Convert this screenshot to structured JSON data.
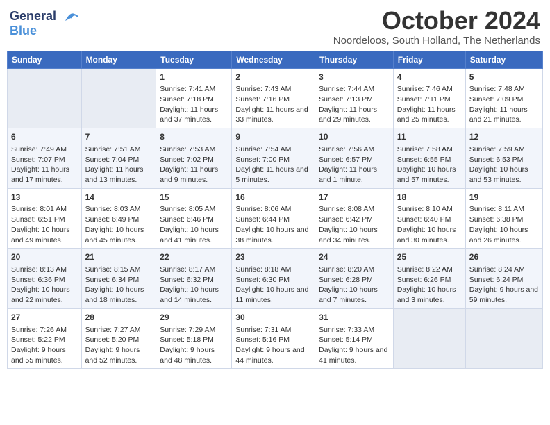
{
  "logo": {
    "line1": "General",
    "line2": "Blue"
  },
  "title": "October 2024",
  "subtitle": "Noordeloos, South Holland, The Netherlands",
  "days_header": [
    "Sunday",
    "Monday",
    "Tuesday",
    "Wednesday",
    "Thursday",
    "Friday",
    "Saturday"
  ],
  "weeks": [
    [
      {
        "day": "",
        "sunrise": "",
        "sunset": "",
        "daylight": ""
      },
      {
        "day": "",
        "sunrise": "",
        "sunset": "",
        "daylight": ""
      },
      {
        "day": "1",
        "sunrise": "Sunrise: 7:41 AM",
        "sunset": "Sunset: 7:18 PM",
        "daylight": "Daylight: 11 hours and 37 minutes."
      },
      {
        "day": "2",
        "sunrise": "Sunrise: 7:43 AM",
        "sunset": "Sunset: 7:16 PM",
        "daylight": "Daylight: 11 hours and 33 minutes."
      },
      {
        "day": "3",
        "sunrise": "Sunrise: 7:44 AM",
        "sunset": "Sunset: 7:13 PM",
        "daylight": "Daylight: 11 hours and 29 minutes."
      },
      {
        "day": "4",
        "sunrise": "Sunrise: 7:46 AM",
        "sunset": "Sunset: 7:11 PM",
        "daylight": "Daylight: 11 hours and 25 minutes."
      },
      {
        "day": "5",
        "sunrise": "Sunrise: 7:48 AM",
        "sunset": "Sunset: 7:09 PM",
        "daylight": "Daylight: 11 hours and 21 minutes."
      }
    ],
    [
      {
        "day": "6",
        "sunrise": "Sunrise: 7:49 AM",
        "sunset": "Sunset: 7:07 PM",
        "daylight": "Daylight: 11 hours and 17 minutes."
      },
      {
        "day": "7",
        "sunrise": "Sunrise: 7:51 AM",
        "sunset": "Sunset: 7:04 PM",
        "daylight": "Daylight: 11 hours and 13 minutes."
      },
      {
        "day": "8",
        "sunrise": "Sunrise: 7:53 AM",
        "sunset": "Sunset: 7:02 PM",
        "daylight": "Daylight: 11 hours and 9 minutes."
      },
      {
        "day": "9",
        "sunrise": "Sunrise: 7:54 AM",
        "sunset": "Sunset: 7:00 PM",
        "daylight": "Daylight: 11 hours and 5 minutes."
      },
      {
        "day": "10",
        "sunrise": "Sunrise: 7:56 AM",
        "sunset": "Sunset: 6:57 PM",
        "daylight": "Daylight: 11 hours and 1 minute."
      },
      {
        "day": "11",
        "sunrise": "Sunrise: 7:58 AM",
        "sunset": "Sunset: 6:55 PM",
        "daylight": "Daylight: 10 hours and 57 minutes."
      },
      {
        "day": "12",
        "sunrise": "Sunrise: 7:59 AM",
        "sunset": "Sunset: 6:53 PM",
        "daylight": "Daylight: 10 hours and 53 minutes."
      }
    ],
    [
      {
        "day": "13",
        "sunrise": "Sunrise: 8:01 AM",
        "sunset": "Sunset: 6:51 PM",
        "daylight": "Daylight: 10 hours and 49 minutes."
      },
      {
        "day": "14",
        "sunrise": "Sunrise: 8:03 AM",
        "sunset": "Sunset: 6:49 PM",
        "daylight": "Daylight: 10 hours and 45 minutes."
      },
      {
        "day": "15",
        "sunrise": "Sunrise: 8:05 AM",
        "sunset": "Sunset: 6:46 PM",
        "daylight": "Daylight: 10 hours and 41 minutes."
      },
      {
        "day": "16",
        "sunrise": "Sunrise: 8:06 AM",
        "sunset": "Sunset: 6:44 PM",
        "daylight": "Daylight: 10 hours and 38 minutes."
      },
      {
        "day": "17",
        "sunrise": "Sunrise: 8:08 AM",
        "sunset": "Sunset: 6:42 PM",
        "daylight": "Daylight: 10 hours and 34 minutes."
      },
      {
        "day": "18",
        "sunrise": "Sunrise: 8:10 AM",
        "sunset": "Sunset: 6:40 PM",
        "daylight": "Daylight: 10 hours and 30 minutes."
      },
      {
        "day": "19",
        "sunrise": "Sunrise: 8:11 AM",
        "sunset": "Sunset: 6:38 PM",
        "daylight": "Daylight: 10 hours and 26 minutes."
      }
    ],
    [
      {
        "day": "20",
        "sunrise": "Sunrise: 8:13 AM",
        "sunset": "Sunset: 6:36 PM",
        "daylight": "Daylight: 10 hours and 22 minutes."
      },
      {
        "day": "21",
        "sunrise": "Sunrise: 8:15 AM",
        "sunset": "Sunset: 6:34 PM",
        "daylight": "Daylight: 10 hours and 18 minutes."
      },
      {
        "day": "22",
        "sunrise": "Sunrise: 8:17 AM",
        "sunset": "Sunset: 6:32 PM",
        "daylight": "Daylight: 10 hours and 14 minutes."
      },
      {
        "day": "23",
        "sunrise": "Sunrise: 8:18 AM",
        "sunset": "Sunset: 6:30 PM",
        "daylight": "Daylight: 10 hours and 11 minutes."
      },
      {
        "day": "24",
        "sunrise": "Sunrise: 8:20 AM",
        "sunset": "Sunset: 6:28 PM",
        "daylight": "Daylight: 10 hours and 7 minutes."
      },
      {
        "day": "25",
        "sunrise": "Sunrise: 8:22 AM",
        "sunset": "Sunset: 6:26 PM",
        "daylight": "Daylight: 10 hours and 3 minutes."
      },
      {
        "day": "26",
        "sunrise": "Sunrise: 8:24 AM",
        "sunset": "Sunset: 6:24 PM",
        "daylight": "Daylight: 9 hours and 59 minutes."
      }
    ],
    [
      {
        "day": "27",
        "sunrise": "Sunrise: 7:26 AM",
        "sunset": "Sunset: 5:22 PM",
        "daylight": "Daylight: 9 hours and 55 minutes."
      },
      {
        "day": "28",
        "sunrise": "Sunrise: 7:27 AM",
        "sunset": "Sunset: 5:20 PM",
        "daylight": "Daylight: 9 hours and 52 minutes."
      },
      {
        "day": "29",
        "sunrise": "Sunrise: 7:29 AM",
        "sunset": "Sunset: 5:18 PM",
        "daylight": "Daylight: 9 hours and 48 minutes."
      },
      {
        "day": "30",
        "sunrise": "Sunrise: 7:31 AM",
        "sunset": "Sunset: 5:16 PM",
        "daylight": "Daylight: 9 hours and 44 minutes."
      },
      {
        "day": "31",
        "sunrise": "Sunrise: 7:33 AM",
        "sunset": "Sunset: 5:14 PM",
        "daylight": "Daylight: 9 hours and 41 minutes."
      },
      {
        "day": "",
        "sunrise": "",
        "sunset": "",
        "daylight": ""
      },
      {
        "day": "",
        "sunrise": "",
        "sunset": "",
        "daylight": ""
      }
    ]
  ]
}
